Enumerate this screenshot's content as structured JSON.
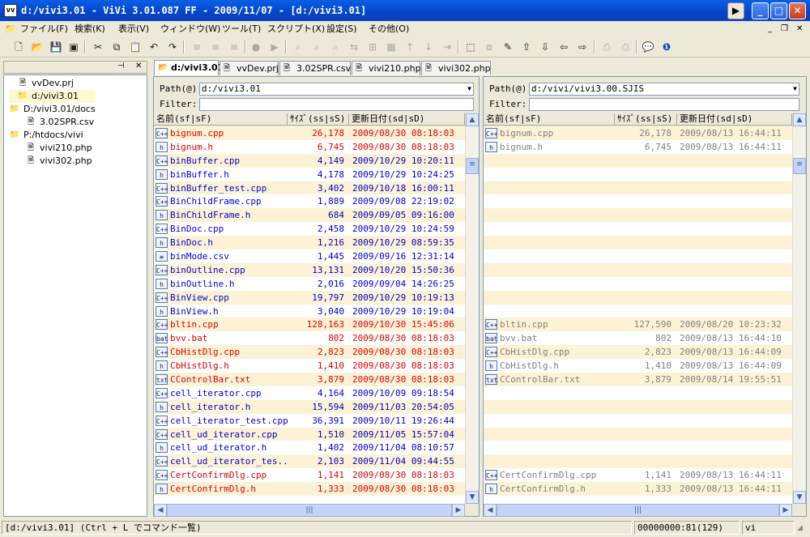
{
  "window": {
    "title": "d:/vivi3.01 - ViVi 3.01.087 FF - 2009/11/07 - [d:/vivi3.01]"
  },
  "menu": [
    "ファイル(F)",
    "検索(K)",
    "表示(V)",
    "ウィンドウ(W)",
    "ツール(T)",
    "スクリプト(X)",
    "設定(S)",
    "その他(O)"
  ],
  "tabs": [
    "d:/vivi3.01",
    "vvDev.prj",
    "3.02SPR.csv",
    "vivi210.php",
    "vivi302.php"
  ],
  "tree": [
    {
      "label": "vvDev.prj",
      "indent": 1,
      "icon": "project-icon"
    },
    {
      "label": "d:/vivi3.01",
      "indent": 1,
      "icon": "folder-icon"
    },
    {
      "label": "D:/vivi3.01/docs",
      "indent": 0,
      "icon": "folder-icon"
    },
    {
      "label": "3.02SPR.csv",
      "indent": 2,
      "icon": "file-icon"
    },
    {
      "label": "P:/htdocs/vivi",
      "indent": 0,
      "icon": "folder-icon"
    },
    {
      "label": "vivi210.php",
      "indent": 2,
      "icon": "file-icon"
    },
    {
      "label": "vivi302.php",
      "indent": 2,
      "icon": "file-icon"
    }
  ],
  "left": {
    "path_label": "Path(@):",
    "path_value": "d:/vivi3.01",
    "filter_label": "Filter:",
    "filter_value": "",
    "headers": [
      "名前(sf|sF)",
      "ｻｲｽﾞ(ss|sS)",
      "更新日付(sd|sD)"
    ],
    "rows": [
      {
        "name": "bignum.cpp",
        "size": "26,178",
        "date": "2009/08/30 08:18:03",
        "color": "#e00000",
        "icon": "C++"
      },
      {
        "name": "bignum.h",
        "size": "6,745",
        "date": "2009/08/30 08:18:03",
        "color": "#e00000",
        "icon": "h"
      },
      {
        "name": "binBuffer.cpp",
        "size": "4,149",
        "date": "2009/10/29 10:20:11",
        "color": "#0000cc",
        "icon": "C++"
      },
      {
        "name": "binBuffer.h",
        "size": "4,178",
        "date": "2009/10/29 10:24:25",
        "color": "#0000cc",
        "icon": "h"
      },
      {
        "name": "binBuffer_test.cpp",
        "size": "3,402",
        "date": "2009/10/18 16:00:11",
        "color": "#0000cc",
        "icon": "C++"
      },
      {
        "name": "BinChildFrame.cpp",
        "size": "1,889",
        "date": "2009/09/08 22:19:02",
        "color": "#0000cc",
        "icon": "C++"
      },
      {
        "name": "BinChildFrame.h",
        "size": "684",
        "date": "2009/09/05 09:16:00",
        "color": "#0000cc",
        "icon": "h"
      },
      {
        "name": "BinDoc.cpp",
        "size": "2,458",
        "date": "2009/10/29 10:24:59",
        "color": "#0000cc",
        "icon": "C++"
      },
      {
        "name": "BinDoc.h",
        "size": "1,216",
        "date": "2009/10/29 08:59:35",
        "color": "#0000cc",
        "icon": "h"
      },
      {
        "name": "binMode.csv",
        "size": "1,445",
        "date": "2009/09/16 12:31:14",
        "color": "#0000cc",
        "icon": "csv"
      },
      {
        "name": "binOutline.cpp",
        "size": "13,131",
        "date": "2009/10/20 15:50:36",
        "color": "#0000cc",
        "icon": "C++"
      },
      {
        "name": "binOutline.h",
        "size": "2,016",
        "date": "2009/09/04 14:26:25",
        "color": "#0000cc",
        "icon": "h"
      },
      {
        "name": "BinView.cpp",
        "size": "19,797",
        "date": "2009/10/29 10:19:13",
        "color": "#0000cc",
        "icon": "C++"
      },
      {
        "name": "BinView.h",
        "size": "3,040",
        "date": "2009/10/29 10:19:04",
        "color": "#0000cc",
        "icon": "h"
      },
      {
        "name": "bltin.cpp",
        "size": "128,163",
        "date": "2009/10/30 15:45:06",
        "color": "#e00000",
        "icon": "C++"
      },
      {
        "name": "bvv.bat",
        "size": "802",
        "date": "2009/08/30 08:18:03",
        "color": "#e00000",
        "icon": "bat"
      },
      {
        "name": "CbHistDlg.cpp",
        "size": "2,823",
        "date": "2009/08/30 08:18:03",
        "color": "#e00000",
        "icon": "C++"
      },
      {
        "name": "CbHistDlg.h",
        "size": "1,410",
        "date": "2009/08/30 08:18:03",
        "color": "#e00000",
        "icon": "h"
      },
      {
        "name": "CControlBar.txt",
        "size": "3,879",
        "date": "2009/08/30 08:18:03",
        "color": "#e00000",
        "icon": "txt"
      },
      {
        "name": "cell_iterator.cpp",
        "size": "4,164",
        "date": "2009/10/09 09:18:54",
        "color": "#0000cc",
        "icon": "C++"
      },
      {
        "name": "cell_iterator.h",
        "size": "15,594",
        "date": "2009/11/03 20:54:05",
        "color": "#0000cc",
        "icon": "h"
      },
      {
        "name": "cell_iterator_test.cpp",
        "size": "36,391",
        "date": "2009/10/11 19:26:44",
        "color": "#0000cc",
        "icon": "C++"
      },
      {
        "name": "cell_ud_iterator.cpp",
        "size": "1,510",
        "date": "2009/11/05 15:57:04",
        "color": "#0000cc",
        "icon": "C++"
      },
      {
        "name": "cell_ud_iterator.h",
        "size": "1,402",
        "date": "2009/11/04 08:10:57",
        "color": "#0000cc",
        "icon": "h"
      },
      {
        "name": "cell_ud_iterator_tes...",
        "size": "2,103",
        "date": "2009/11/04 09:44:55",
        "color": "#0000cc",
        "icon": "C++"
      },
      {
        "name": "CertConfirmDlg.cpp",
        "size": "1,141",
        "date": "2009/08/30 08:18:03",
        "color": "#e00000",
        "icon": "C++"
      },
      {
        "name": "CertConfirmDlg.h",
        "size": "1,333",
        "date": "2009/08/30 08:18:03",
        "color": "#e00000",
        "icon": "h"
      }
    ]
  },
  "right": {
    "path_label": "Path(@):",
    "path_value": "d:/vivi/vivi3.00.SJIS",
    "filter_label": "Filter:",
    "filter_value": "",
    "headers": [
      "名前(sf|sF)",
      "ｻｲｽﾞ(ss|sS)",
      "更新日付(sd|sD)"
    ],
    "rows": [
      {
        "name": "bignum.cpp",
        "size": "26,178",
        "date": "2009/08/13 16:44:11",
        "icon": "C++"
      },
      {
        "name": "bignum.h",
        "size": "6,745",
        "date": "2009/08/13 16:44:11",
        "icon": "h"
      },
      {},
      {},
      {},
      {},
      {},
      {},
      {},
      {},
      {},
      {},
      {},
      {},
      {
        "name": "bltin.cpp",
        "size": "127,590",
        "date": "2009/08/20 10:23:32",
        "icon": "C++"
      },
      {
        "name": "bvv.bat",
        "size": "802",
        "date": "2009/08/13 16:44:10",
        "icon": "bat"
      },
      {
        "name": "CbHistDlg.cpp",
        "size": "2,823",
        "date": "2009/08/13 16:44:09",
        "icon": "C++"
      },
      {
        "name": "CbHistDlg.h",
        "size": "1,410",
        "date": "2009/08/13 16:44:09",
        "icon": "h"
      },
      {
        "name": "CControlBar.txt",
        "size": "3,879",
        "date": "2009/08/14 19:55:51",
        "icon": "txt"
      },
      {},
      {},
      {},
      {},
      {},
      {},
      {
        "name": "CertConfirmDlg.cpp",
        "size": "1,141",
        "date": "2009/08/13 16:44:11",
        "icon": "C++"
      },
      {
        "name": "CertConfirmDlg.h",
        "size": "1,333",
        "date": "2009/08/13 16:44:11",
        "icon": "h"
      }
    ]
  },
  "status": {
    "message": "[d:/vivi3.01] (Ctrl + L でコマンド一覧)",
    "position": "00000000:81(129)",
    "mode": "vi"
  },
  "colors": {
    "changed": "#e00000",
    "same": "#0000cc",
    "right_text": "#808080",
    "alt_row": "#fcf3d6"
  }
}
